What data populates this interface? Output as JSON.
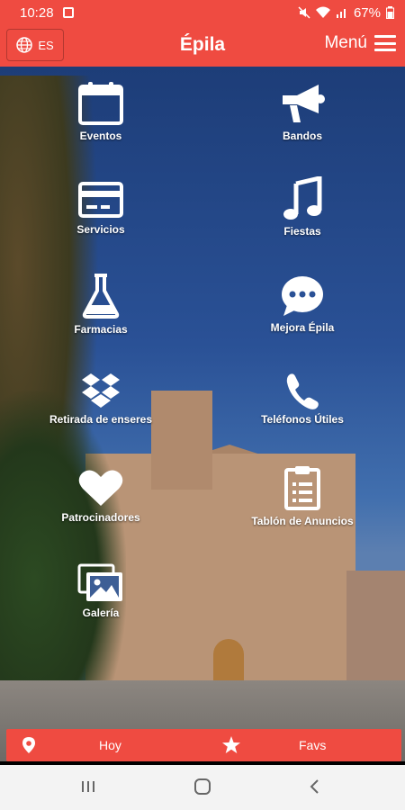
{
  "status_bar": {
    "time": "10:28",
    "battery": "67%"
  },
  "header": {
    "lang_label": "ES",
    "title": "Épila",
    "menu_label": "Menú"
  },
  "grid": [
    {
      "label": "Eventos",
      "icon": "calendar-icon"
    },
    {
      "label": "Bandos",
      "icon": "megaphone-icon"
    },
    {
      "label": "Servicios",
      "icon": "credit-card-icon"
    },
    {
      "label": "Fiestas",
      "icon": "music-note-icon"
    },
    {
      "label": "Farmacias",
      "icon": "flask-icon"
    },
    {
      "label": "Mejora Épila",
      "icon": "chat-bubble-icon"
    },
    {
      "label": "Retirada de enseres",
      "icon": "dropbox-icon"
    },
    {
      "label": "Teléfonos Útiles",
      "icon": "phone-icon"
    },
    {
      "label": "Patrocinadores",
      "icon": "heart-icon"
    },
    {
      "label": "Tablón de Anuncios",
      "icon": "clipboard-icon"
    },
    {
      "label": "Galería",
      "icon": "images-icon"
    }
  ],
  "bottom_bar": {
    "today_label": "Hoy",
    "favs_label": "Favs"
  },
  "colors": {
    "accent": "#ef4b41"
  }
}
